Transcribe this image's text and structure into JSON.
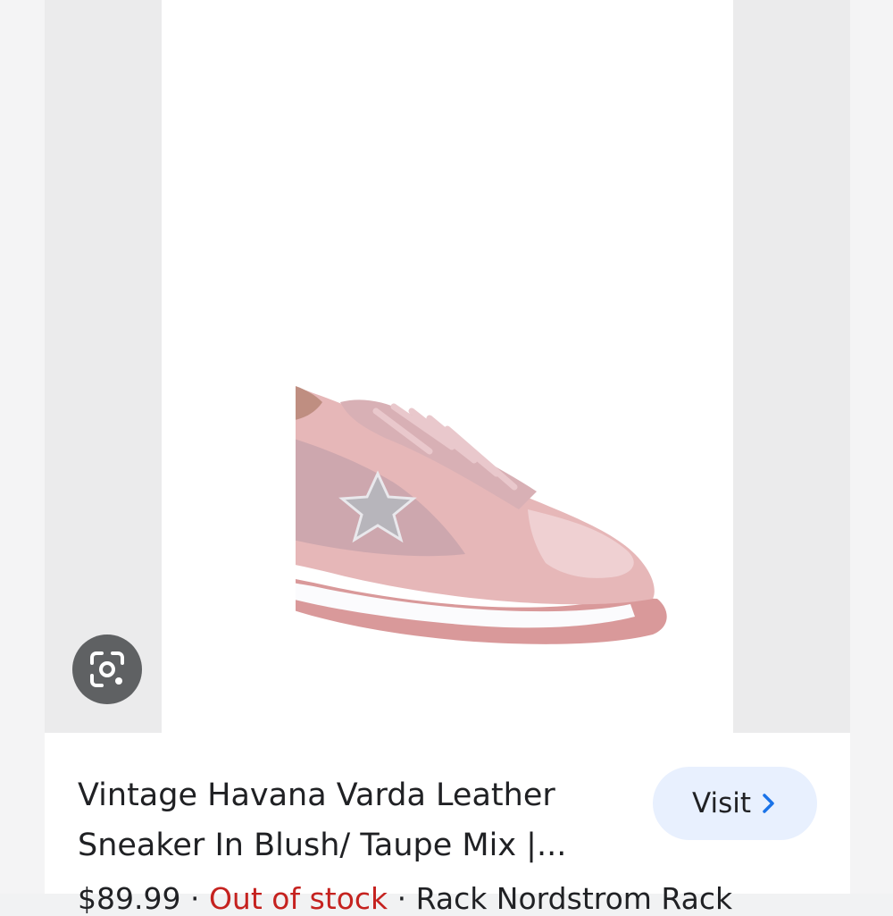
{
  "result": {
    "title": "Vintage Havana Varda Leather Sneaker In Blush/ Taupe Mix |...",
    "visit_label": "Visit",
    "price_partial": "$89.99",
    "sale_partial": "Out of stock",
    "seller_partial": "Rack Nordstrom Rack"
  },
  "icons": {
    "lens": "google-lens-icon",
    "visit_chevron": "chevron-right-icon"
  },
  "colors": {
    "visit_bg": "#e8f0fe",
    "chevron": "#1a73e8",
    "lens_bg": "#5f6163"
  }
}
